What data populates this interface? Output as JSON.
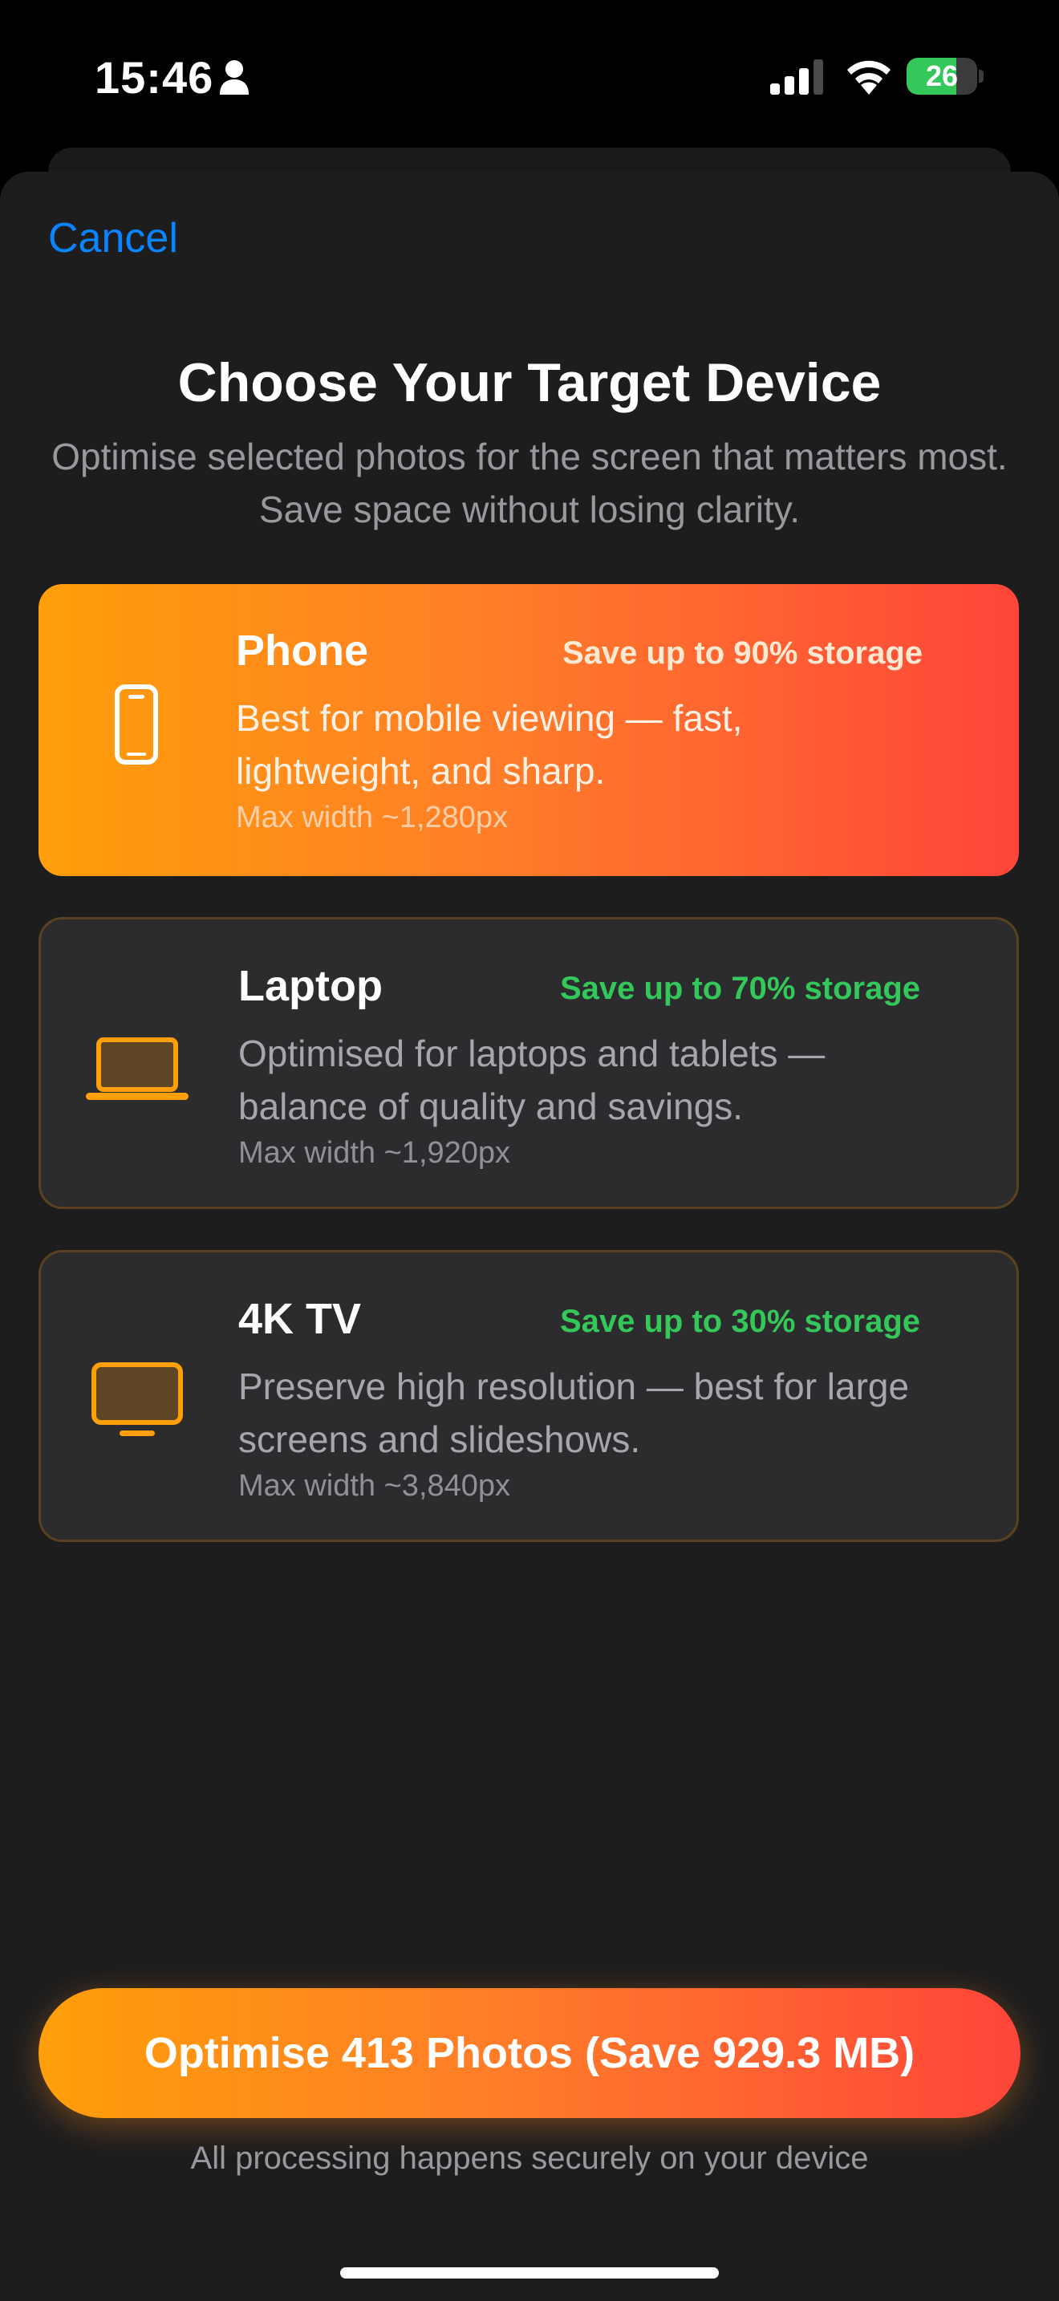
{
  "status_bar": {
    "time": "15:46",
    "battery_level": "26",
    "icons": [
      "person-icon",
      "cellular-signal-icon",
      "wifi-icon",
      "battery-charging-icon"
    ]
  },
  "sheet": {
    "cancel_label": "Cancel",
    "title": "Choose Your Target Device",
    "subtitle": "Optimise selected photos for the screen that matters most. Save space without losing clarity."
  },
  "devices": [
    {
      "name": "Phone",
      "icon": "smartphone-icon",
      "savings": "Save up to 90% storage",
      "description": "Best for mobile viewing — fast, lightweight, and sharp.",
      "max_width": "Max width ~1,280px",
      "selected": true
    },
    {
      "name": "Laptop",
      "icon": "laptop-icon",
      "savings": "Save up to 70% storage",
      "description": "Optimised for laptops and tablets — balance of quality and savings.",
      "max_width": "Max width ~1,920px",
      "selected": false
    },
    {
      "name": "4K TV",
      "icon": "tv-icon",
      "savings": "Save up to 30% storage",
      "description": "Preserve high resolution — best for large screens and slideshows.",
      "max_width": "Max width ~3,840px",
      "selected": false
    }
  ],
  "cta": {
    "label": "Optimise 413 Photos (Save 929.3 MB)"
  },
  "footer": {
    "note": "All processing happens securely on your device"
  },
  "colors": {
    "accent_blue": "#0a84ff",
    "gradient_start": "#ff9f0a",
    "gradient_end": "#ff453a",
    "savings_green": "#34c759",
    "icon_orange": "#ff9f0a",
    "sheet_background": "#1d1d1e",
    "card_background": "#2c2c2e"
  }
}
